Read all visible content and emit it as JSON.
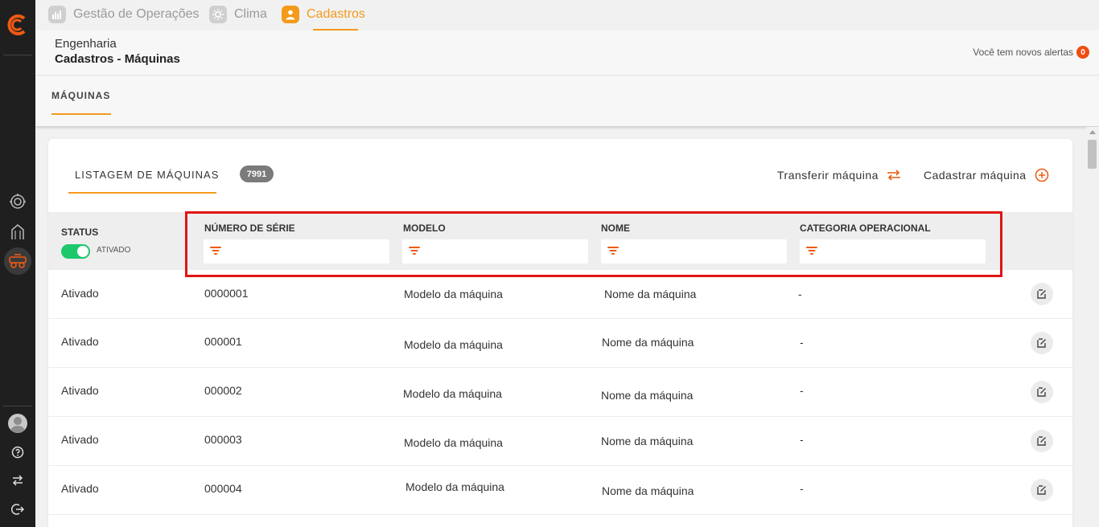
{
  "modules": [
    {
      "label": "Gestão de Operações",
      "icon": "operations-chart-icon"
    },
    {
      "label": "Clima",
      "icon": "sun-icon"
    },
    {
      "label": "Cadastros",
      "icon": "user-icon"
    }
  ],
  "header": {
    "breadcrumb_area": "Engenharia",
    "breadcrumb_page": "Cadastros - Máquinas",
    "alerts_text": "Você tem novos alertas",
    "alerts_count": "0"
  },
  "section": {
    "tab": "MÁQUINAS"
  },
  "card": {
    "tab_label": "LISTAGEM DE MÁQUINAS",
    "count": "7991",
    "transfer_label": "Transferir máquina",
    "register_label": "Cadastrar máquina"
  },
  "table": {
    "status_header": "STATUS",
    "status_toggle_label": "ATIVADO",
    "columns": [
      "NÚMERO DE SÉRIE",
      "MODELO",
      "NOME",
      "CATEGORIA OPERACIONAL"
    ],
    "rows": [
      [
        "Ativado",
        "0000001",
        "Modelo da máquina",
        "Nome da máquina",
        "-"
      ],
      [
        "Ativado",
        "000001",
        "Modelo da máquina",
        "Nome da máquina",
        "-"
      ],
      [
        "Ativado",
        "000002",
        "Modelo da máquina",
        "Nome da máquina",
        "-"
      ],
      [
        "Ativado",
        "000003",
        "Modelo da máquina",
        "Nome da máquina",
        "-"
      ],
      [
        "Ativado",
        "000004",
        "Modelo da máquina",
        "Nome da máquina",
        "-"
      ]
    ]
  },
  "colors": {
    "accent": "#f39a1b",
    "alert": "#ee4d12",
    "toggle_on": "#1cc86a",
    "highlight": "#e21414",
    "sidebar": "#1f1f1f"
  }
}
